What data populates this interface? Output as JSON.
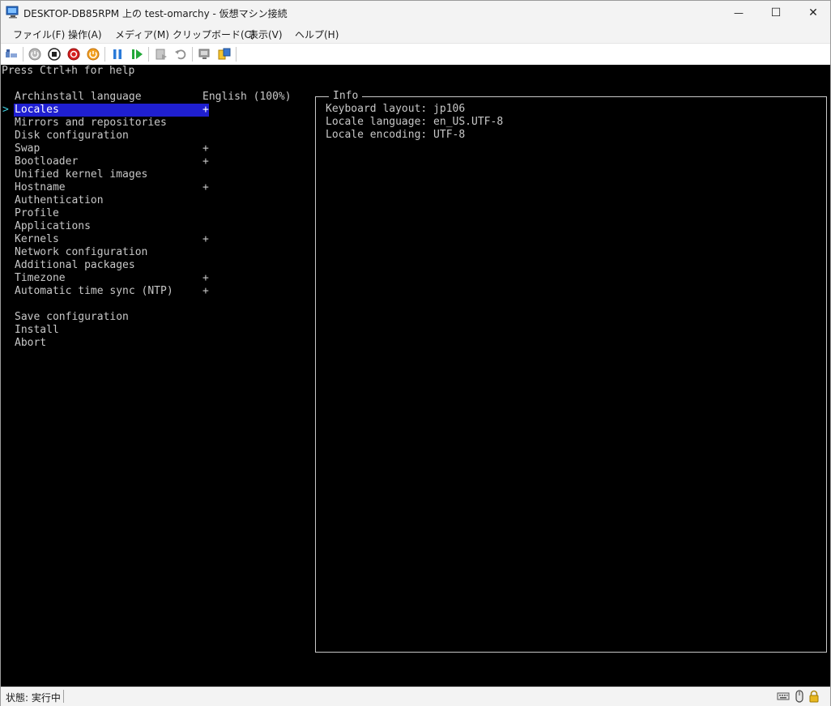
{
  "window": {
    "title": "DESKTOP-DB85RPM 上の test-omarchy - 仮想マシン接続",
    "minimize_glyph": "—",
    "maximize_glyph": "☐",
    "close_glyph": "✕"
  },
  "menubar": {
    "items": [
      {
        "label": "ファイル(F)"
      },
      {
        "label": "操作(A)"
      },
      {
        "label": "メディア(M)"
      },
      {
        "label": "クリップボード(C)"
      },
      {
        "label": "表示(V)"
      },
      {
        "label": "ヘルプ(H)"
      }
    ]
  },
  "toolbar": {
    "icons": [
      "ctrl-alt-del-icon",
      "start-icon",
      "turn-off-icon",
      "shutdown-icon",
      "power-icon",
      "pause-icon",
      "resume-icon",
      "checkpoint-icon",
      "revert-icon",
      "enhanced-session-icon",
      "share-icon"
    ]
  },
  "terminal": {
    "help_line": "Press Ctrl+h for help",
    "selected_marker": ">",
    "plus_marker": "+",
    "menu": [
      {
        "label": "Archinstall language",
        "value": "English (100%)",
        "plus": false,
        "selected": false
      },
      {
        "label": "Locales",
        "value": "",
        "plus": true,
        "selected": true
      },
      {
        "label": "Mirrors and repositories",
        "value": "",
        "plus": false,
        "selected": false
      },
      {
        "label": "Disk configuration",
        "value": "",
        "plus": false,
        "selected": false
      },
      {
        "label": "Swap",
        "value": "",
        "plus": true,
        "selected": false
      },
      {
        "label": "Bootloader",
        "value": "",
        "plus": true,
        "selected": false
      },
      {
        "label": "Unified kernel images",
        "value": "",
        "plus": false,
        "selected": false
      },
      {
        "label": "Hostname",
        "value": "",
        "plus": true,
        "selected": false
      },
      {
        "label": "Authentication",
        "value": "",
        "plus": false,
        "selected": false
      },
      {
        "label": "Profile",
        "value": "",
        "plus": false,
        "selected": false
      },
      {
        "label": "Applications",
        "value": "",
        "plus": false,
        "selected": false
      },
      {
        "label": "Kernels",
        "value": "",
        "plus": true,
        "selected": false
      },
      {
        "label": "Network configuration",
        "value": "",
        "plus": false,
        "selected": false
      },
      {
        "label": "Additional packages",
        "value": "",
        "plus": false,
        "selected": false
      },
      {
        "label": "Timezone",
        "value": "",
        "plus": true,
        "selected": false
      },
      {
        "label": "Automatic time sync (NTP)",
        "value": "",
        "plus": true,
        "selected": false
      }
    ],
    "actions": [
      {
        "label": "Save configuration"
      },
      {
        "label": "Install"
      },
      {
        "label": "Abort"
      }
    ],
    "info": {
      "title": "Info",
      "lines": [
        "Keyboard layout: jp106",
        "Locale language: en_US.UTF-8",
        "Locale encoding: UTF-8"
      ]
    }
  },
  "statusbar": {
    "status": "状態: 実行中",
    "icons": [
      "keyboard-icon",
      "mouse-icon",
      "lock-icon"
    ]
  },
  "colors": {
    "selection_bg": "#1f1fd0",
    "arrow": "#3fd0e0",
    "terminal_fg": "#c8c8c8"
  }
}
